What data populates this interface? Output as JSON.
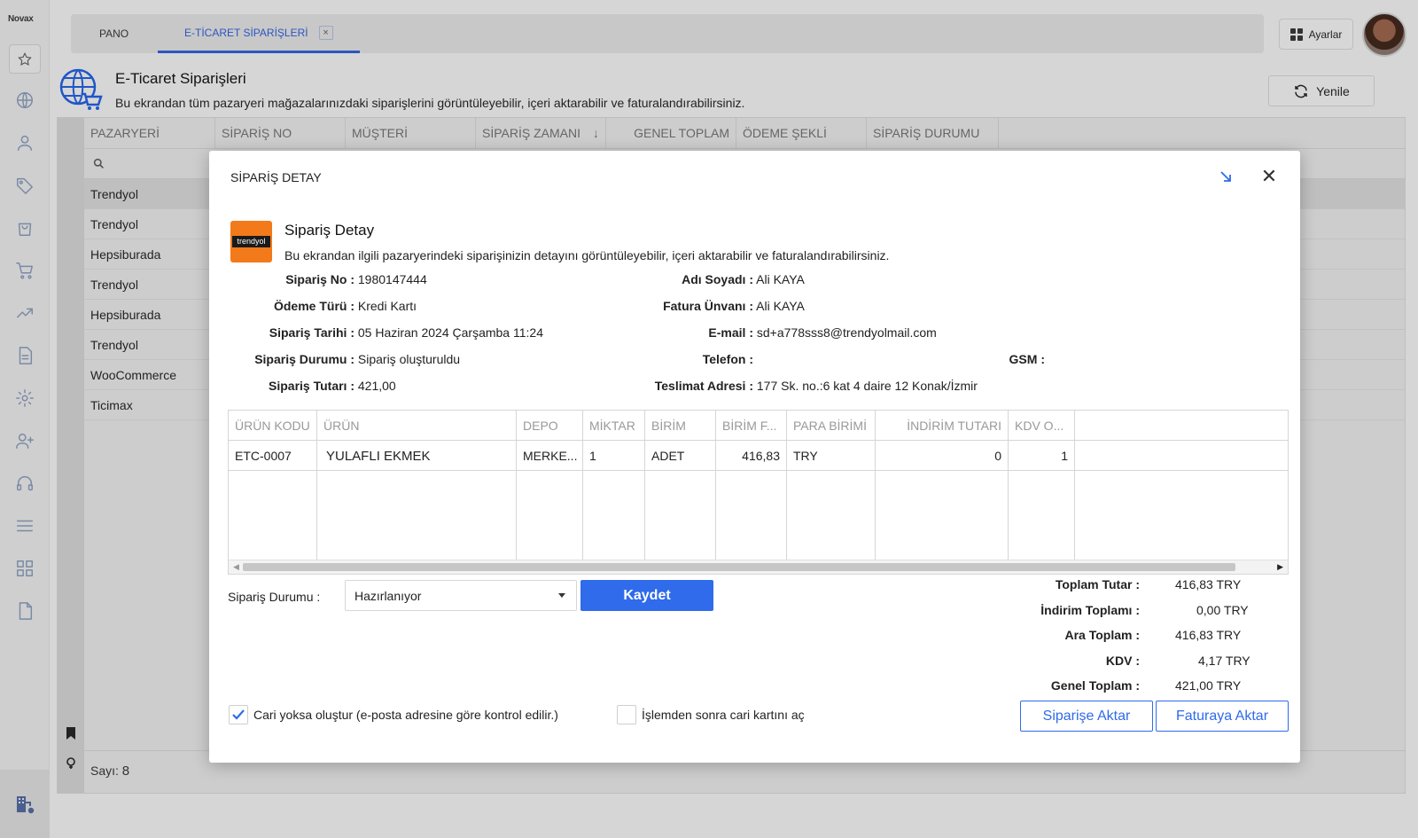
{
  "app": {
    "logo": "Novax"
  },
  "tabs": [
    {
      "label": "PANO"
    },
    {
      "label": "E-TİCARET SİPARİŞLERİ",
      "close": "×"
    }
  ],
  "header": {
    "settings_label": "Ayarlar",
    "title": "E-Ticaret Siparişleri",
    "description": "Bu ekrandan tüm pazaryeri mağazalarınızdaki siparişlerini görüntüleyebilir, içeri aktarabilir ve faturalandırabilirsiniz.",
    "refresh_label": "Yenile"
  },
  "grid": {
    "columns": [
      "PAZARYERİ",
      "SİPARİŞ NO",
      "MÜŞTERİ",
      "SİPARİŞ ZAMANI",
      "GENEL TOPLAM",
      "ÖDEME ŞEKLİ",
      "SİPARİŞ DURUMU"
    ],
    "sort_icon": "↓",
    "rows": [
      "Trendyol",
      "Trendyol",
      "Hepsiburada",
      "Trendyol",
      "Hepsiburada",
      "Trendyol",
      "WooCommerce",
      "Ticimax"
    ],
    "count_label": "Sayı:",
    "count_value": "8"
  },
  "modal": {
    "title": "SİPARİŞ DETAY",
    "logo_text": "trendyol",
    "detail_title": "Sipariş Detay",
    "detail_desc": "Bu ekrandan ilgili pazaryerindeki siparişinizin detayını görüntüleyebilir, içeri aktarabilir ve faturalandırabilirsiniz.",
    "info_left": [
      {
        "k": "Sipariş No :",
        "v": "1980147444"
      },
      {
        "k": "Ödeme Türü :",
        "v": "Kredi Kartı"
      },
      {
        "k": "Sipariş Tarihi :",
        "v": "05 Haziran 2024 Çarşamba 11:24"
      },
      {
        "k": "Sipariş Durumu :",
        "v": "Sipariş oluşturuldu"
      },
      {
        "k": "Sipariş Tutarı :",
        "v": "421,00"
      }
    ],
    "info_right": [
      {
        "k": "Adı Soyadı :",
        "v": "Ali KAYA"
      },
      {
        "k": "Fatura Ünvanı :",
        "v": "Ali KAYA"
      },
      {
        "k": "E-mail :",
        "v": "sd+a778sss8@trendyolmail.com"
      },
      {
        "k": "Telefon :",
        "v": ""
      },
      {
        "k": "Teslimat Adresi :",
        "v": "177 Sk. no.:6 kat 4 daire 12 Konak/İzmir"
      }
    ],
    "gsm": {
      "k": "GSM :",
      "v": ""
    },
    "items": {
      "columns": [
        "ÜRÜN KODU",
        "ÜRÜN",
        "DEPO",
        "MİKTAR",
        "BİRİM",
        "BİRİM F...",
        "PARA BİRİMİ",
        "İNDİRİM TUTARI",
        "KDV O..."
      ],
      "rows": [
        [
          "ETC-0007",
          "YULAFLI EKMEK",
          "MERKE...",
          "1",
          "ADET",
          "416,83",
          "TRY",
          "0",
          "1"
        ]
      ]
    },
    "status_label": "Sipariş Durumu :",
    "status_value": "Hazırlanıyor",
    "save_label": "Kaydet",
    "totals": [
      {
        "k": "Toplam Tutar :",
        "v": "416,83",
        "c": "TRY"
      },
      {
        "k": "İndirim Toplamı :",
        "v": "0,00",
        "c": "TRY"
      },
      {
        "k": "Ara Toplam :",
        "v": "416,83",
        "c": "TRY"
      },
      {
        "k": "KDV :",
        "v": "4,17",
        "c": "TRY"
      },
      {
        "k": "Genel Toplam :",
        "v": "421,00",
        "c": "TRY"
      }
    ],
    "check1_label": "Cari yoksa oluştur (e-posta adresine göre kontrol edilir.)",
    "check1_checked": true,
    "check2_label": "İşlemden sonra cari kartını aç",
    "check2_checked": false,
    "btn_order": "Siparişe Aktar",
    "btn_invoice": "Faturaya Aktar"
  }
}
